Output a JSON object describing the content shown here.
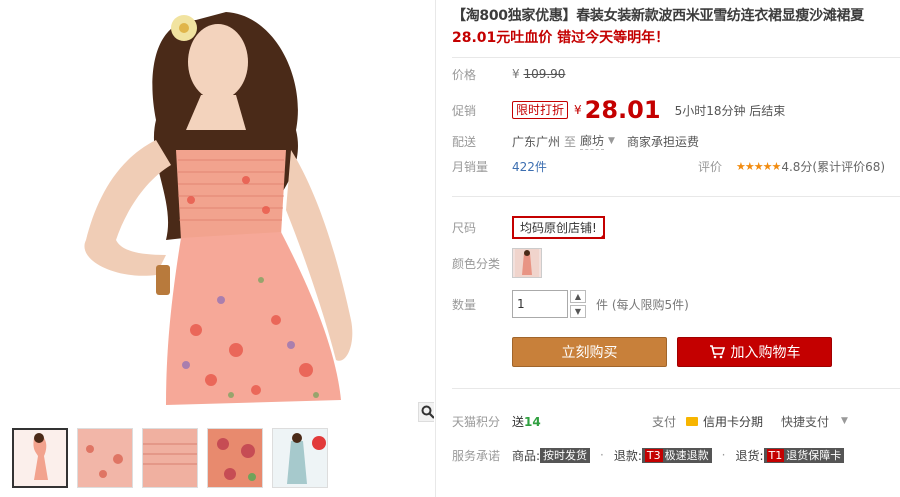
{
  "product": {
    "title": "【淘800独家优惠】春装女装新款波西米亚雪纺连衣裙显瘦沙滩裙夏",
    "subtitle": "28.01元吐血价 错过今天等明年！"
  },
  "price": {
    "label": "价格",
    "original": "¥ 109.90",
    "original_prefix": "¥ ",
    "original_value": "109.90"
  },
  "promo": {
    "label": "促销",
    "tag": "限时打折",
    "currency": "¥",
    "value": "28.01",
    "countdown": "5小时18分钟 后结束"
  },
  "shipping": {
    "label": "配送",
    "from": "广东广州",
    "to_word": "至",
    "destination": "廊坊",
    "note": "商家承担运费"
  },
  "sales": {
    "label": "月销量",
    "count": "422件",
    "rating_label": "评价",
    "stars": 5,
    "score": "4.8分(累计评价68)"
  },
  "options": {
    "size_label": "尺码",
    "size_value": "均码原创店铺!",
    "color_label": "颜色分类",
    "qty_label": "数量",
    "qty_value": "1",
    "qty_unit": "件 (每人限购5件)"
  },
  "actions": {
    "buy_now": "立刻购买",
    "add_cart": "加入购物车"
  },
  "services": {
    "points_label": "天猫积分",
    "points_prefix": "送",
    "points_value": "14",
    "pay_label": "支付",
    "credit_card": "信用卡分期",
    "quick_pay": "快捷支付",
    "promise_label": "服务承诺",
    "goods_label": "商品:",
    "goods_tag": "按时发货",
    "refund_label": "退款:",
    "refund_tag_code": "T3",
    "refund_tag": "极速退款",
    "return_label": "退货:",
    "return_tag_code": "T1",
    "return_tag": "退货保障卡"
  },
  "colors": {
    "accent": "#c40000",
    "buy_button": "#c8803a",
    "link": "#3d6fb1",
    "stars": "#f28c10"
  }
}
